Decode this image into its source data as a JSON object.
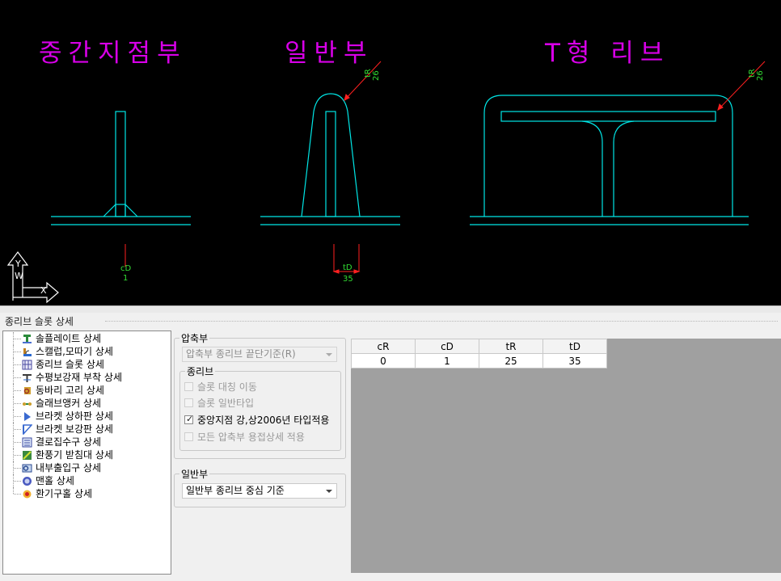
{
  "drawing": {
    "titles": [
      "중간지점부",
      "일반부",
      "T형 리브"
    ],
    "dimensions": {
      "cD_label": "cD",
      "cD_value": "1",
      "tD_label": "tD",
      "tD_value": "35",
      "tR_label_1": "tR",
      "tR_value_1": "26",
      "tR_label_2": "tR",
      "tR_value_2": "26"
    },
    "ucs_axes": [
      "Y",
      "X"
    ],
    "colors": {
      "background": "#000000",
      "geometry": "#00e5e5",
      "title": "#d800e8",
      "dimension_text": "#33dd33",
      "dimension_line": "#ff2020"
    }
  },
  "panel": {
    "title": "종리브 슬롯 상세"
  },
  "tree": {
    "items": [
      {
        "label": "솔플레이트 상세",
        "icon": "sole-plate-icon"
      },
      {
        "label": "스캘럽,모따기 상세",
        "icon": "scallop-icon"
      },
      {
        "label": "종리브 슬롯 상세",
        "icon": "rib-slot-icon"
      },
      {
        "label": "수평보강재 부착 상세",
        "icon": "stiffener-icon"
      },
      {
        "label": "동바리 고리 상세",
        "icon": "shoring-ring-icon"
      },
      {
        "label": "슬래브앵커 상세",
        "icon": "slab-anchor-icon"
      },
      {
        "label": "브라켓 상하판 상세",
        "icon": "bracket-flange-icon"
      },
      {
        "label": "브라켓 보강판 상세",
        "icon": "bracket-stiffener-icon"
      },
      {
        "label": "결로집수구 상세",
        "icon": "drain-icon"
      },
      {
        "label": "환풍기 받침대 상세",
        "icon": "fan-support-icon"
      },
      {
        "label": "내부출입구 상세",
        "icon": "access-door-icon"
      },
      {
        "label": "맨홀 상세",
        "icon": "manhole-icon"
      },
      {
        "label": "환기구홀 상세",
        "icon": "vent-hole-icon"
      }
    ]
  },
  "compression": {
    "legend": "압축부",
    "select_value": "압축부 종리브  끝단기준(R)",
    "rib_group": {
      "legend": "종리브",
      "options": [
        {
          "label": "슬롯 대칭 이동",
          "checked": false
        },
        {
          "label": "슬롯 일반타입",
          "checked": false
        },
        {
          "label": "중앙지점 강,상2006년 타입적용",
          "checked": true
        },
        {
          "label": "모든 압축부 용접상세 적용",
          "checked": false
        }
      ]
    }
  },
  "general": {
    "legend": "일반부",
    "select_value": "일반부 종리브 중심 기준"
  },
  "grid": {
    "headers": [
      "cR",
      "cD",
      "tR",
      "tD"
    ],
    "rows": [
      [
        "0",
        "1",
        "25",
        "35"
      ]
    ]
  }
}
